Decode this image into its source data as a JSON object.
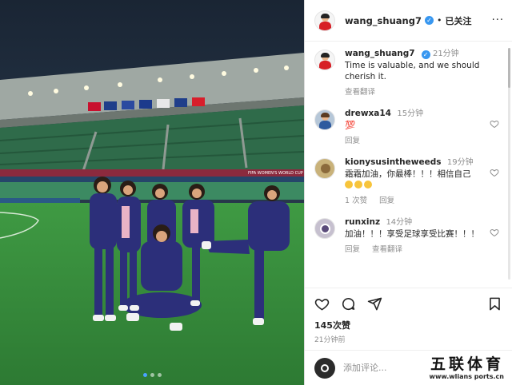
{
  "post": {
    "username": "wang_shuang7",
    "follow_status": "已关注",
    "more_symbol": "···",
    "caption": {
      "username": "wang_shuang7",
      "time": "21分钟",
      "text": "Time is valuable, and we should cherish it.",
      "translate": "查看翻译"
    },
    "likes": "145次赞",
    "post_time": "21分钟前",
    "add_comment_placeholder": "添加评论...",
    "photo_slide_count": 3
  },
  "comments": [
    {
      "username": "drewxa14",
      "time": "15分钟",
      "text": "💯",
      "actions": [
        "回复"
      ]
    },
    {
      "username": "kionysusintheweeds",
      "time": "19分钟",
      "text": "霜霜加油，你最棒！！！相信自己",
      "actions": [
        "1 次赞",
        "回复"
      ]
    },
    {
      "username": "runxinz",
      "time": "14分钟",
      "text": "加油！！！享受足球享受比赛！！！",
      "actions": [
        "回复",
        "查看翻译"
      ]
    }
  ],
  "stadium_banner": "FIFA WOMEN'S WORLD CUP",
  "watermark": {
    "logo": "五联体育",
    "url": "www.wlians ports.cn"
  },
  "colors": {
    "accent": "#3897f0",
    "text": "#262626",
    "muted": "#8e8e8e",
    "jacket": "#2c2f7a"
  }
}
